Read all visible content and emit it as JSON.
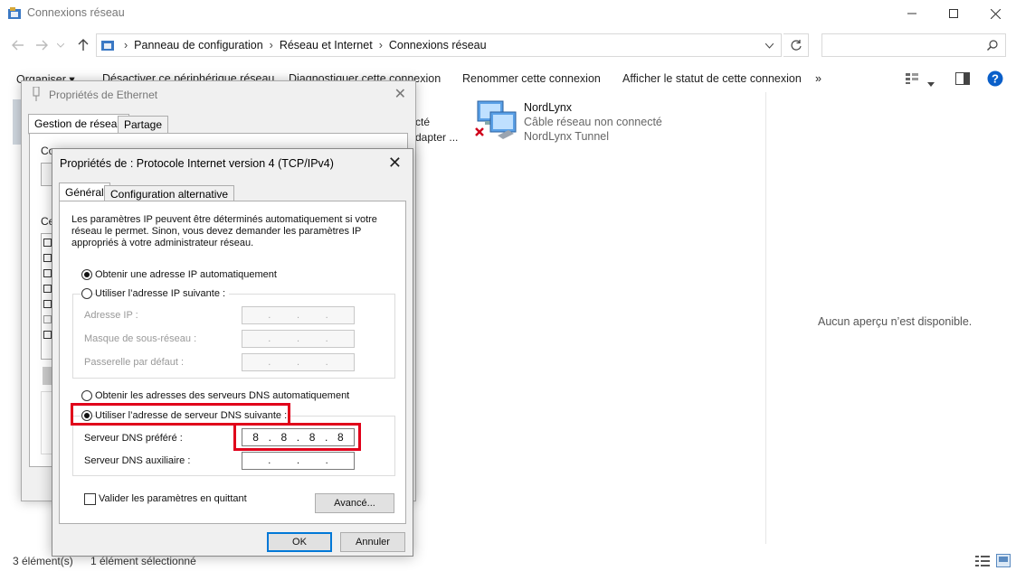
{
  "explorer": {
    "title": "Connexions réseau",
    "breadcrumb": [
      "Panneau de configuration",
      "Réseau et Internet",
      "Connexions réseau"
    ],
    "toolbar": {
      "organize": "Organiser ▾",
      "disable_device": "Désactiver ce périphérique réseau",
      "diagnose": "Diagnostiquer cette connexion",
      "rename": "Renommer cette connexion",
      "status": "Afficher le statut de cette connexion",
      "more": "»"
    },
    "connection": {
      "name": "NordLynx",
      "status": "Câble réseau non connecté",
      "device": "NordLynx Tunnel"
    },
    "partial_texts": [
      "cté",
      "dapter ..."
    ],
    "preview_text": "Aucun aperçu n’est disponible.",
    "status_count": "3 élément(s)",
    "status_selected": "1 élément sélectionné"
  },
  "ethernet_dialog": {
    "title": "Propriétés de Ethernet",
    "tabs": [
      "Gestion de réseau",
      "Partage"
    ],
    "partial_labels": [
      "Connexion en utilisant :",
      "Ce"
    ]
  },
  "tcp_dialog": {
    "title": "Propriétés de : Protocole Internet version 4 (TCP/IPv4)",
    "tabs": [
      "Général",
      "Configuration alternative"
    ],
    "intro": "Les paramètres IP peuvent être déterminés automatiquement si votre réseau le permet. Sinon, vous devez demander les paramètres IP appropriés à votre administrateur réseau.",
    "ip_auto": "Obtenir une adresse IP automatiquement",
    "ip_manual": "Utiliser l’adresse IP suivante :",
    "ip_address_label": "Adresse IP :",
    "subnet_label": "Masque de sous-réseau :",
    "gateway_label": "Passerelle par défaut :",
    "dns_auto": "Obtenir les adresses des serveurs DNS automatiquement",
    "dns_manual": "Utiliser l’adresse de serveur DNS suivante :",
    "dns_preferred_label": "Serveur DNS préféré :",
    "dns_preferred_octets": [
      "8",
      "8",
      "8",
      "8"
    ],
    "dns_alt_label": "Serveur DNS auxiliaire :",
    "validate_label": "Valider les paramètres en quittant",
    "advanced_button": "Avancé...",
    "ok_button": "OK",
    "cancel_button": "Annuler"
  },
  "colors": {
    "highlight": "#e0001a",
    "accent": "#0078d7"
  }
}
